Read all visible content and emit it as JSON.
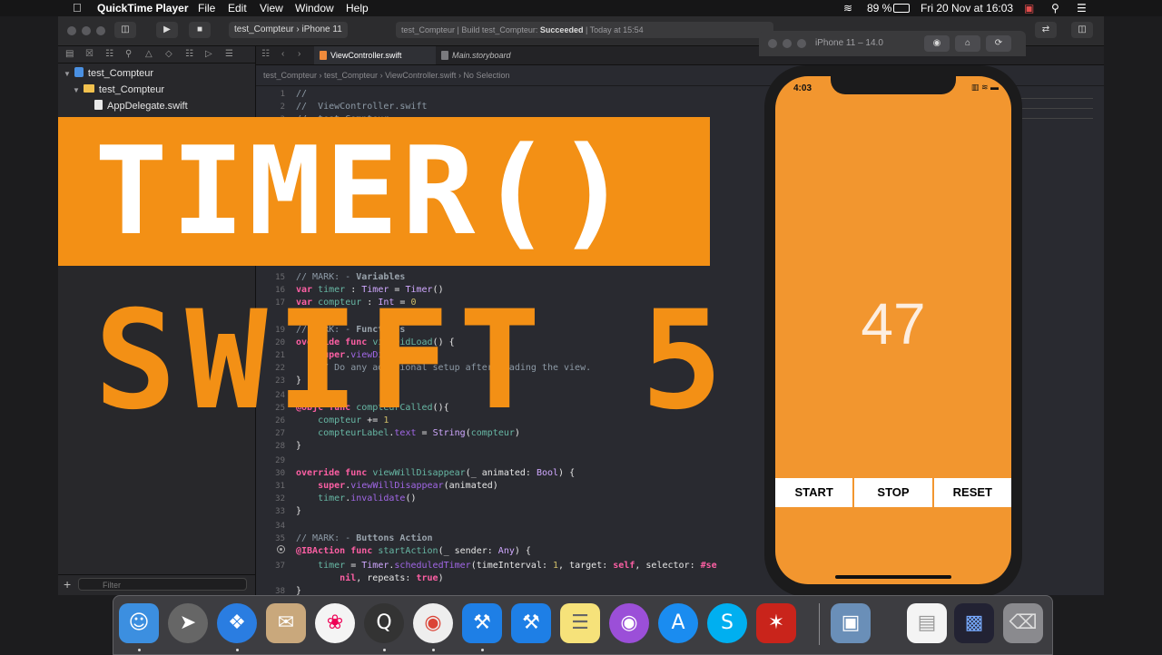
{
  "menubar": {
    "app_name": "QuickTime Player",
    "menus": [
      "File",
      "Edit",
      "View",
      "Window",
      "Help"
    ],
    "battery": "89 %",
    "datetime": "Fri 20 Nov at  16:03"
  },
  "toolbar": {
    "scheme": "test_Compteur",
    "device": "iPhone 11",
    "activity_prefix": "test_Compteur | Build test_Compteur: ",
    "activity_status": "Succeeded",
    "activity_suffix": " | Today at 15:54"
  },
  "navigator": {
    "items": [
      {
        "label": "test_Compteur",
        "kind": "project"
      },
      {
        "label": "test_Compteur",
        "kind": "folder"
      },
      {
        "label": "AppDelegate.swift",
        "kind": "file"
      }
    ],
    "filter_placeholder": "Filter"
  },
  "editor": {
    "tabs": [
      {
        "label": "ViewController.swift",
        "active": true
      },
      {
        "label": "Main.storyboard",
        "active": false
      }
    ],
    "jumpbar": [
      "test_Compteur",
      "test_Compteur",
      "ViewController.swift",
      "No Selection"
    ]
  },
  "overlay": {
    "banner_text": "TIMER()",
    "subtitle_text": "SWIFT 5"
  },
  "simulator": {
    "title": "iPhone 11 – 14.0",
    "status_time": "4:03",
    "counter": "47",
    "buttons": {
      "start": "START",
      "stop": "STOP",
      "reset": "RESET"
    }
  }
}
